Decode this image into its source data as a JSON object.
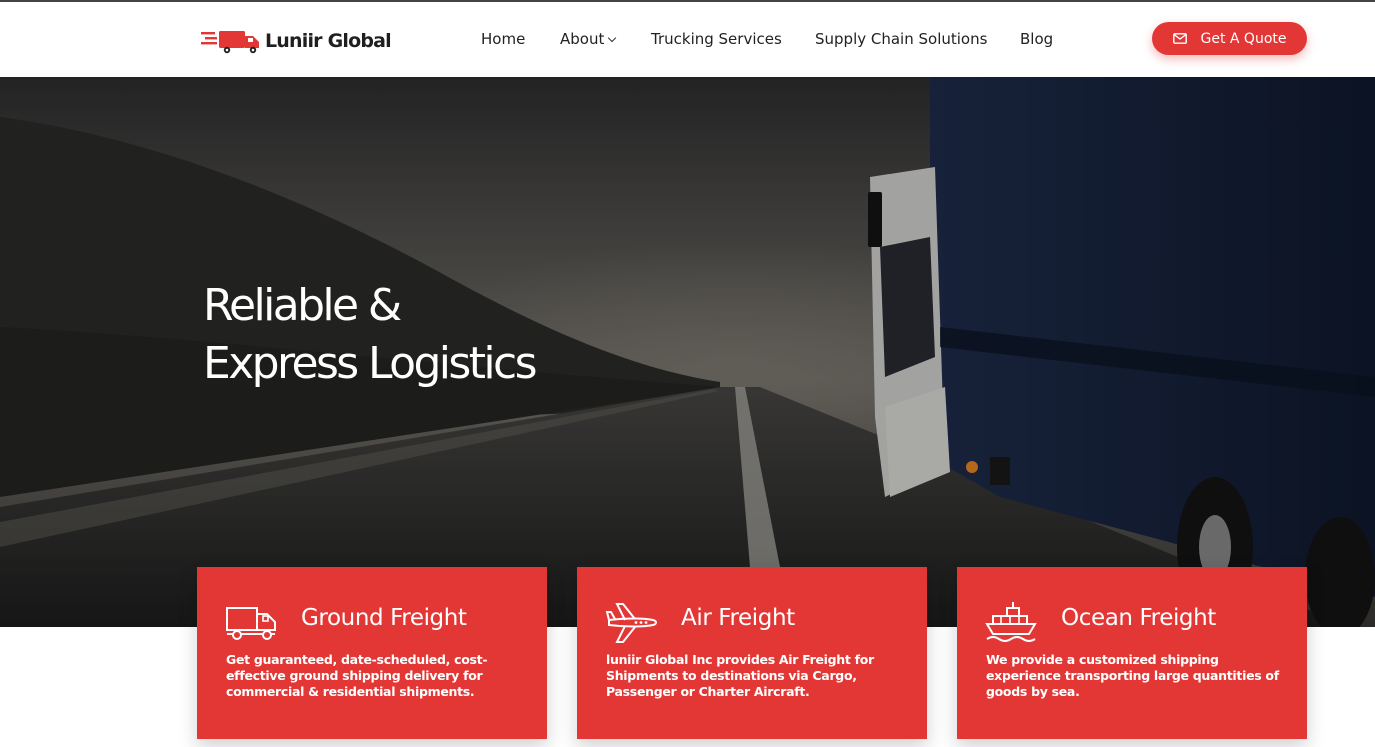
{
  "header": {
    "brand": "Luniir Global",
    "nav": [
      {
        "label": "Home"
      },
      {
        "label": "About"
      },
      {
        "label": "Trucking Services"
      },
      {
        "label": "Supply Chain Solutions"
      },
      {
        "label": "Blog"
      }
    ],
    "quote_button": "Get A Quote",
    "icons": {
      "logo": "truck-logo-icon",
      "about_dropdown": "chevron-down-icon",
      "quote": "envelope-icon"
    }
  },
  "hero": {
    "title_line1": "Reliable &",
    "title_line2": "Express Logistics"
  },
  "services": [
    {
      "title": "Ground Freight",
      "icon": "delivery-truck-icon",
      "description": "Get guaranteed, date-scheduled, cost-effective ground shipping delivery for commercial & residential shipments."
    },
    {
      "title": "Air Freight",
      "icon": "airplane-icon",
      "description": "luniir Global Inc provides Air Freight for Shipments to destinations via Cargo, Passenger or Charter Aircraft."
    },
    {
      "title": "Ocean Freight",
      "icon": "cargo-ship-icon",
      "description": "We provide a customized shipping experience transporting large quantities of goods by sea."
    }
  ],
  "colors": {
    "accent": "#e33736",
    "header_bg": "#ffffff",
    "nav_text": "#222222",
    "hero_text": "#ffffff"
  }
}
